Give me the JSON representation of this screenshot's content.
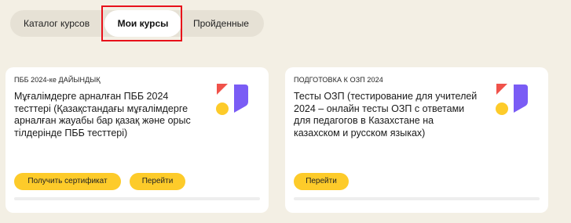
{
  "tabs": {
    "catalog_label": "Каталог курсов",
    "my_courses_label": "Мои курсы",
    "completed_label": "Пройденные"
  },
  "courses": [
    {
      "kicker": "ПББ 2024-ке ДАЙЫНДЫҚ",
      "title": "Мұғалімдерге арналған ПББ 2024 тесттері (Қазақстандағы мұғалімдерге арналған жауабы бар қазақ және орыс тілдерінде ПББ тесттері)",
      "certificate_label": "Получить сертификат",
      "go_label": "Перейти",
      "progress": 0
    },
    {
      "kicker": "ПОДГОТОВКА К ОЗП 2024",
      "title": "Тесты ОЗП (тестирование для учителей 2024 – онлайн тесты ОЗП с ответами для педагогов в Казахстане на казахском и русском языках)",
      "go_label": "Перейти",
      "progress": 0
    }
  ],
  "logo": {
    "icon": "brand-logo-icon",
    "colors": {
      "triangle": "#f0524a",
      "circle": "#fdcb2a",
      "flag": "#7a5cf5"
    }
  },
  "colors": {
    "background": "#f3efe4",
    "tabs_bg": "#e6e1d5",
    "button": "#fdcb2a",
    "highlight": "#e8101a"
  }
}
